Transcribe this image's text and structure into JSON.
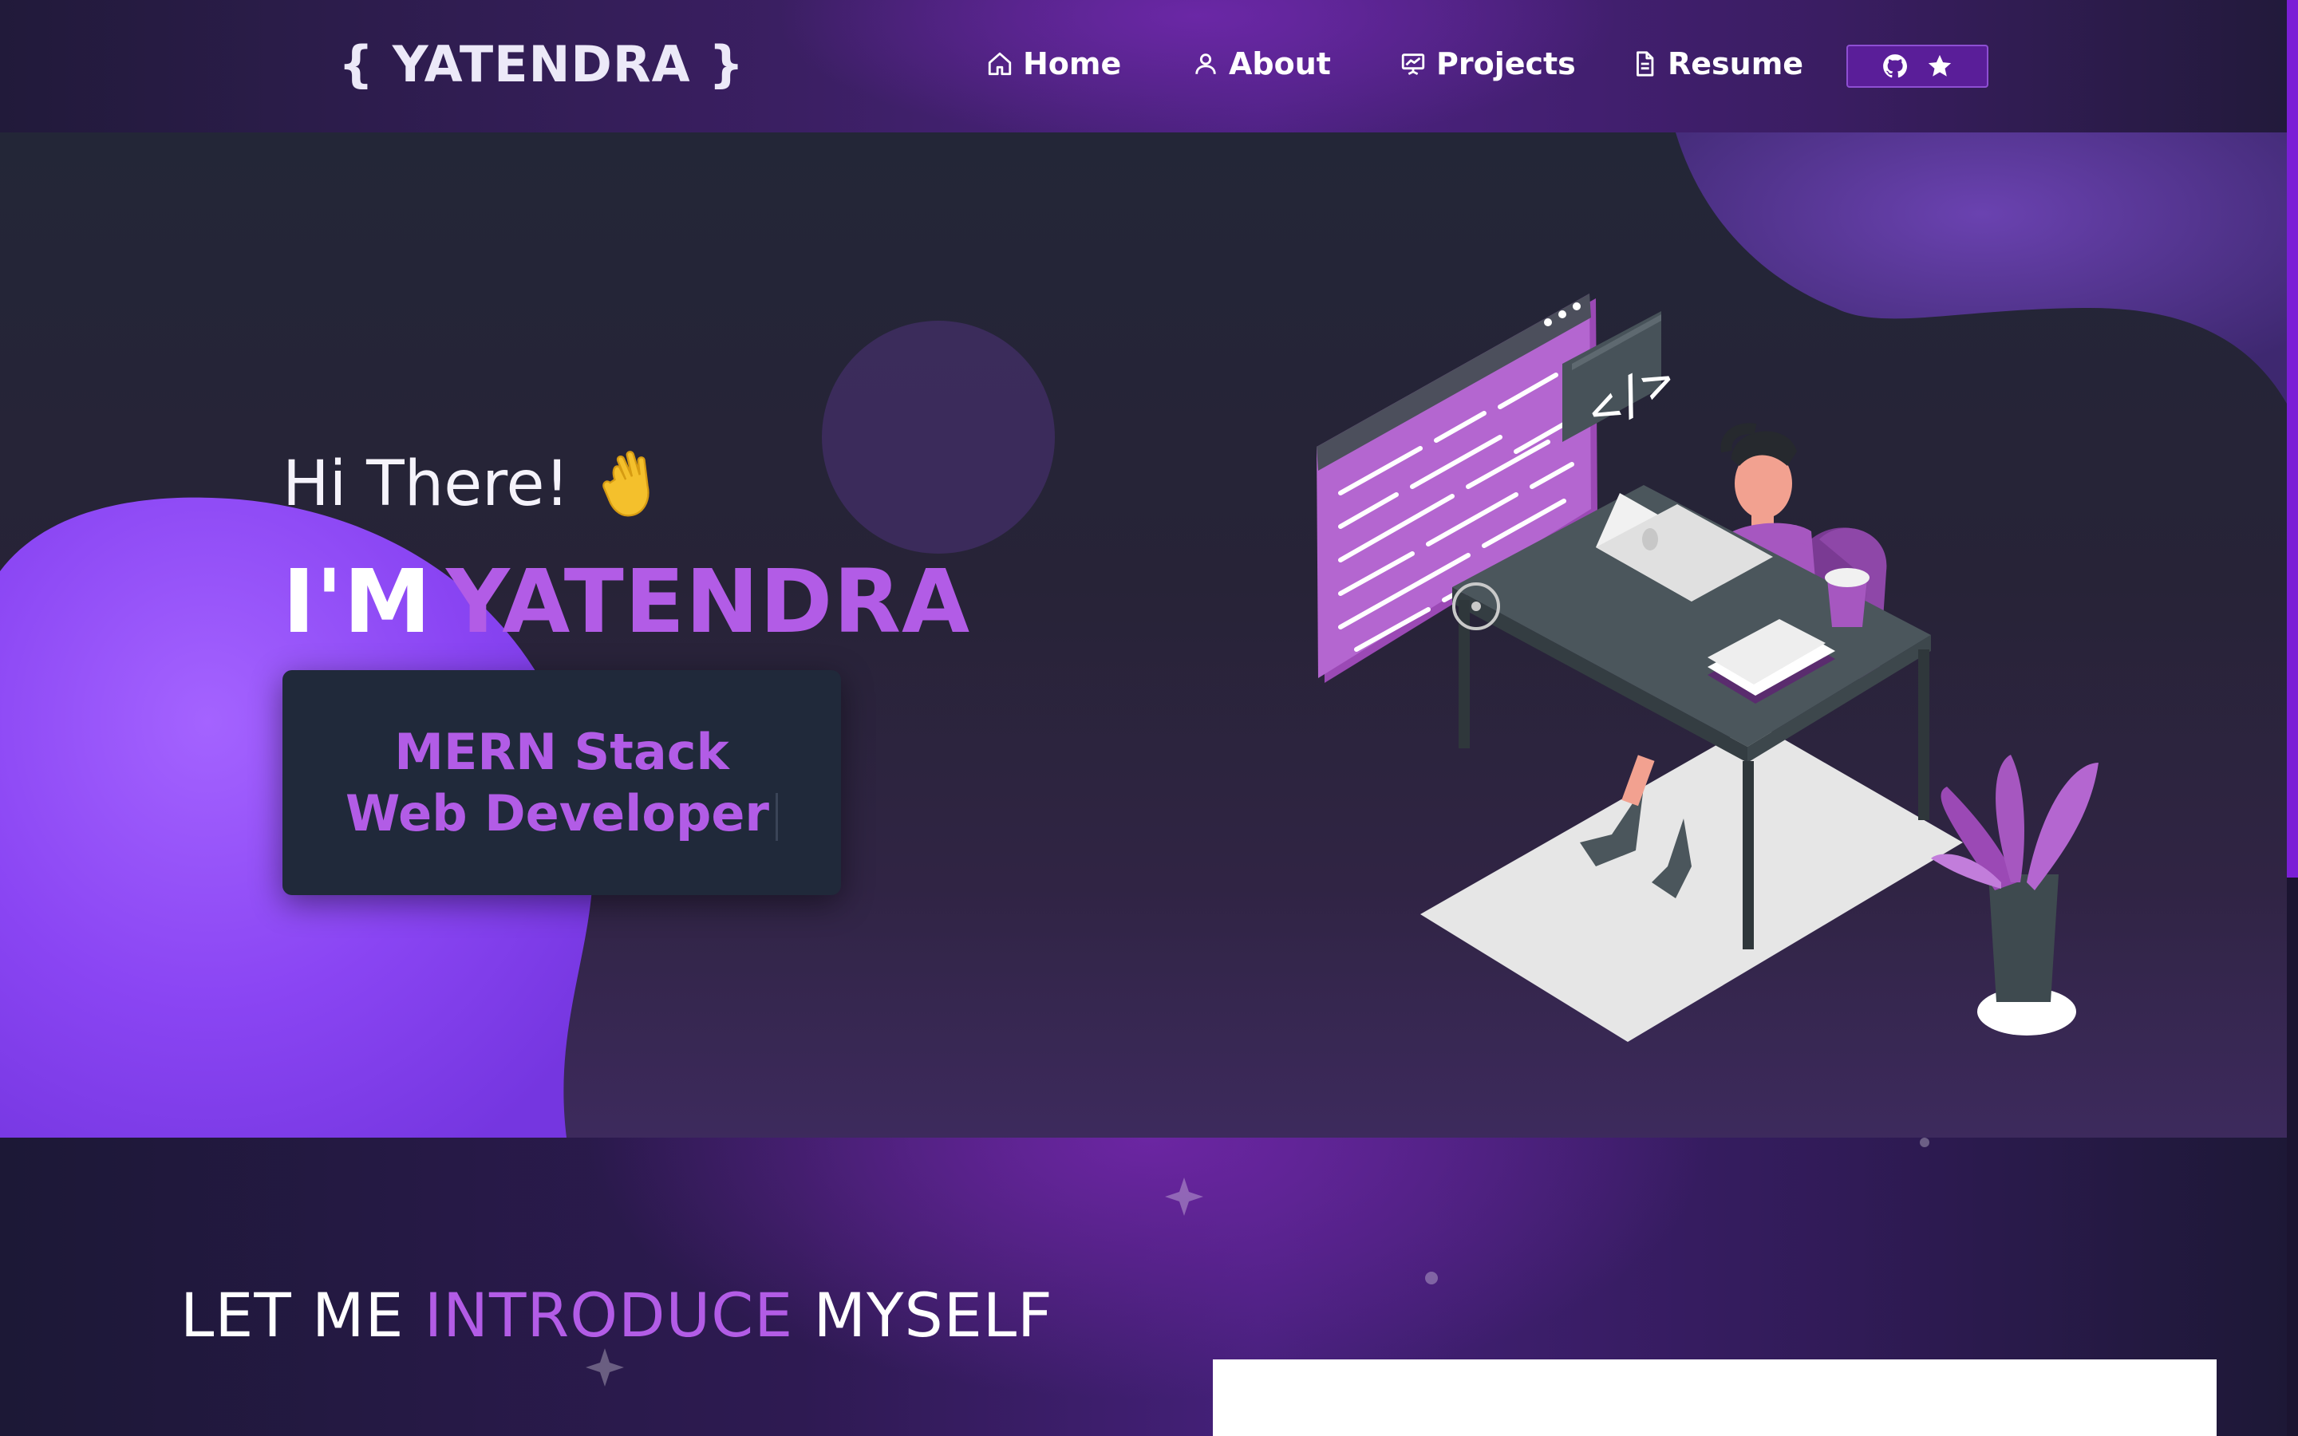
{
  "navbar": {
    "brand": "{ YATENDRA }",
    "items": [
      {
        "label": "Home",
        "icon": "home-icon"
      },
      {
        "label": "About",
        "icon": "user-icon"
      },
      {
        "label": "Projects",
        "icon": "presentation-icon"
      },
      {
        "label": "Resume",
        "icon": "document-icon"
      }
    ],
    "github_button": {
      "icons": [
        "github-icon",
        "star-icon"
      ]
    }
  },
  "hero": {
    "greeting": "Hi There!",
    "greeting_icon": "waving-hand-icon",
    "intro_prefix": "I'M",
    "name": "YATENDRA",
    "role": "MERN Stack Web Developer",
    "illustration": "developer-at-desk-illustration"
  },
  "about": {
    "title_part1": "LET ME",
    "title_highlight": "INTRODUCE",
    "title_part2": "MYSELF"
  },
  "colors": {
    "accent": "#b25ce6",
    "nav_gradient_mid": "#4d2282",
    "hero_bg": "#272337",
    "card_bg": "#20293a",
    "blob": "#8b45f5",
    "github_button": "#5a1e99"
  }
}
